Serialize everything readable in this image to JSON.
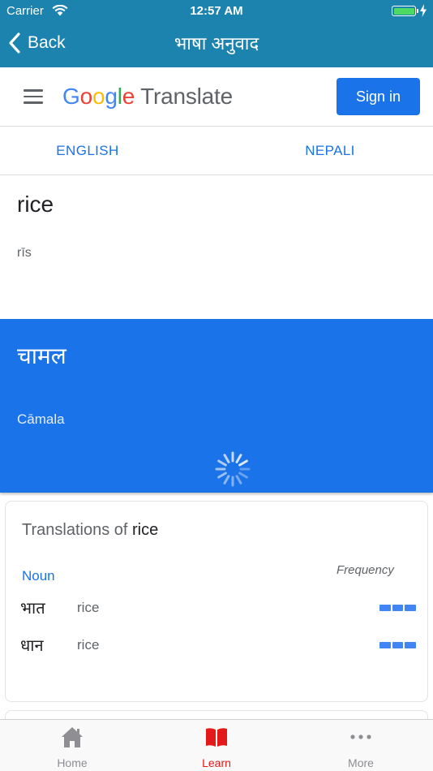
{
  "status_bar": {
    "carrier": "Carrier",
    "time": "12:57 AM"
  },
  "nav": {
    "back_label": "Back",
    "title": "भाषा अनुवाद"
  },
  "header": {
    "logo_letters": [
      "G",
      "o",
      "o",
      "g",
      "l",
      "e"
    ],
    "logo_colors": [
      "#4285f4",
      "#ea4335",
      "#fbbc05",
      "#4285f4",
      "#34a853",
      "#ea4335"
    ],
    "logo_suffix": "Translate",
    "sign_in_label": "Sign in"
  },
  "languages": {
    "source": "ENGLISH",
    "target": "NEPALI"
  },
  "source": {
    "text": "rice",
    "transliteration": "rīs"
  },
  "target": {
    "text": "चामल",
    "transliteration": "Cāmala"
  },
  "translations": {
    "title_prefix": "Translations of ",
    "title_word": "rice",
    "part_of_speech": "Noun",
    "frequency_label": "Frequency",
    "rows": [
      {
        "word": "भात",
        "meaning": "rice",
        "frequency": 3
      },
      {
        "word": "धान",
        "meaning": "rice",
        "frequency": 3
      }
    ]
  },
  "tab_bar": {
    "items": [
      {
        "label": "Home",
        "icon": "home-icon"
      },
      {
        "label": "Learn",
        "icon": "book-icon"
      },
      {
        "label": "More",
        "icon": "more-icon"
      }
    ],
    "active_index": 1
  },
  "colors": {
    "nav_blue": "#1b83ad",
    "google_blue": "#1a73e8",
    "active_tab": "#e41a1a"
  }
}
